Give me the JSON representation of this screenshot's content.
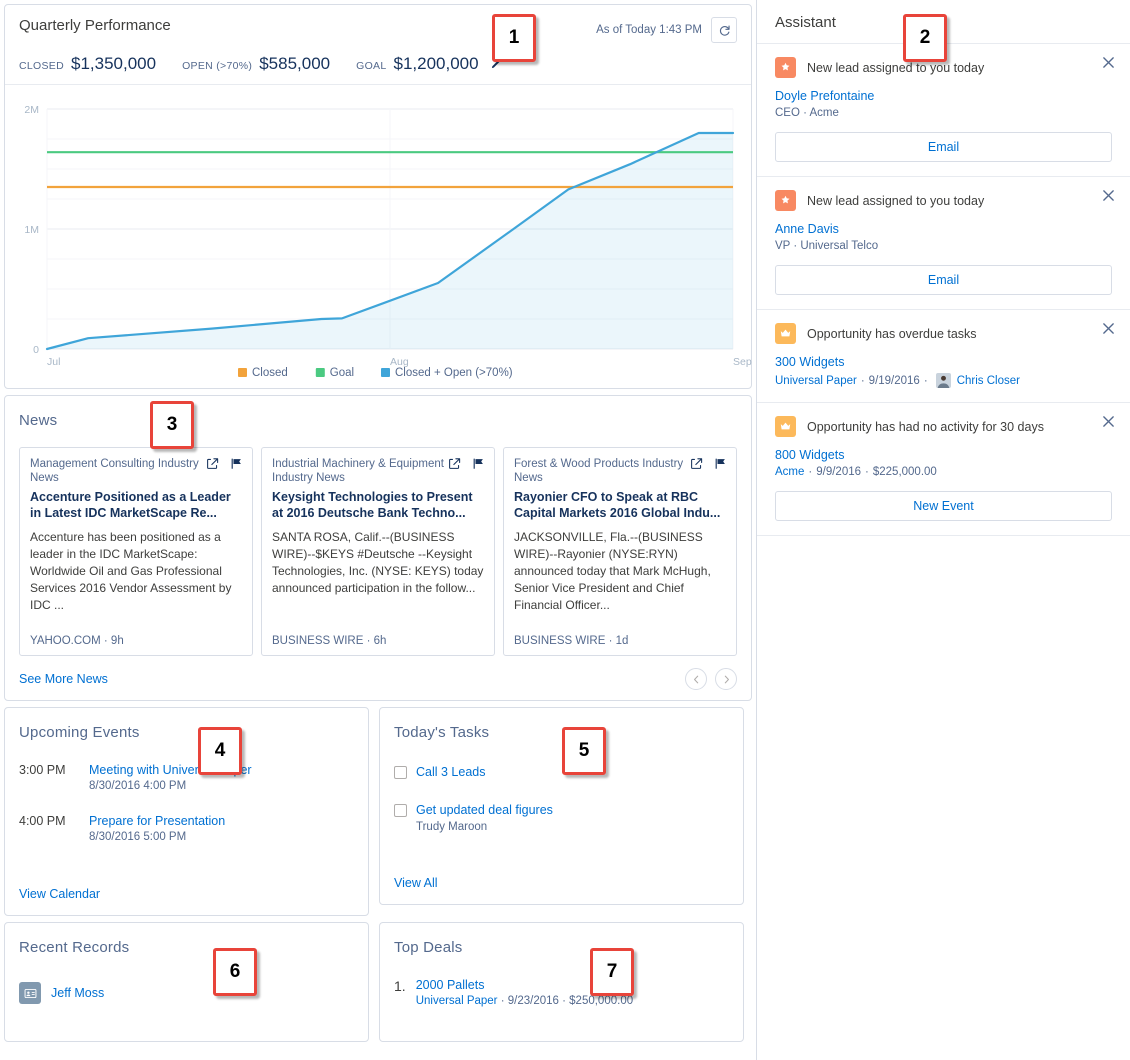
{
  "performance": {
    "title": "Quarterly Performance",
    "as_of": "As of Today 1:43 PM",
    "refresh_icon": "refresh-icon",
    "metrics": [
      {
        "label": "CLOSED",
        "value": "$1,350,000"
      },
      {
        "label": "OPEN (>70%)",
        "value": "$585,000"
      },
      {
        "label": "GOAL",
        "value": "$1,200,000"
      }
    ],
    "edit_icon": "pencil-icon"
  },
  "chart_data": {
    "type": "line",
    "title": "Quarterly Performance",
    "xlabel": "",
    "ylabel": "",
    "ylim": [
      0,
      2000000
    ],
    "yticks": [
      0,
      1000000,
      2000000
    ],
    "ytick_labels": [
      "0",
      "1M",
      "2M"
    ],
    "x": [
      "Jul",
      "Aug",
      "Sep"
    ],
    "xtick_labels": [
      "Jul",
      "Aug",
      "Sep"
    ],
    "grid": true,
    "legend_position": "bottom",
    "series": [
      {
        "name": "Closed",
        "color": "#f2a33c",
        "type": "threshold-line",
        "value": 1350000
      },
      {
        "name": "Goal",
        "color": "#4bca81",
        "type": "threshold-line",
        "value": 1640000
      },
      {
        "name": "Closed + Open (>70%)",
        "color": "#3fa5d9",
        "type": "area-line",
        "points": [
          {
            "x": 0.0,
            "y": 0
          },
          {
            "x": 0.06,
            "y": 90000
          },
          {
            "x": 0.24,
            "y": 170000
          },
          {
            "x": 0.4,
            "y": 250000
          },
          {
            "x": 0.43,
            "y": 255000
          },
          {
            "x": 0.57,
            "y": 550000
          },
          {
            "x": 0.68,
            "y": 1000000
          },
          {
            "x": 0.76,
            "y": 1330000
          },
          {
            "x": 0.85,
            "y": 1540000
          },
          {
            "x": 0.95,
            "y": 1800000
          },
          {
            "x": 1.0,
            "y": 1800000
          }
        ]
      }
    ]
  },
  "news": {
    "title": "News",
    "cards": [
      {
        "category": "Management Consulting Industry News",
        "headline": "Accenture Positioned as a Leader in Latest IDC MarketScape Re...",
        "body": "Accenture has been positioned as a leader in the IDC MarketScape: Worldwide Oil and Gas Professional Services 2016 Vendor Assessment by IDC ...",
        "source": "YAHOO.COM · 9h",
        "share_icon": "share-icon",
        "flag_icon": "flag-icon"
      },
      {
        "category": "Industrial Machinery & Equipment Industry News",
        "headline": "Keysight Technologies to Present at 2016 Deutsche Bank Techno...",
        "body": "SANTA ROSA, Calif.--(BUSINESS WIRE)--$KEYS #Deutsche --Keysight Technologies, Inc. (NYSE: KEYS) today announced participation in the follow...",
        "source": "BUSINESS WIRE · 6h",
        "share_icon": "share-icon",
        "flag_icon": "flag-icon"
      },
      {
        "category": "Forest & Wood Products Industry News",
        "headline": "Rayonier CFO to Speak at RBC Capital Markets 2016 Global Indu...",
        "body": "JACKSONVILLE, Fla.--(BUSINESS WIRE)--Rayonier (NYSE:RYN) announced today that Mark McHugh, Senior Vice President and Chief Financial Officer...",
        "source": "BUSINESS WIRE · 1d",
        "share_icon": "share-icon",
        "flag_icon": "flag-icon"
      }
    ],
    "see_more": "See More News",
    "prev_icon": "chevron-left-icon",
    "next_icon": "chevron-right-icon"
  },
  "events": {
    "title": "Upcoming Events",
    "items": [
      {
        "time": "3:00 PM",
        "name": "Meeting with Universal Paper",
        "detail": "8/30/2016 4:00 PM"
      },
      {
        "time": "4:00 PM",
        "name": "Prepare for Presentation",
        "detail": "8/30/2016 5:00 PM"
      }
    ],
    "view_link": "View Calendar"
  },
  "tasks": {
    "title": "Today's Tasks",
    "items": [
      {
        "name": "Call 3 Leads",
        "detail": ""
      },
      {
        "name": "Get updated deal figures",
        "detail": "Trudy Maroon"
      }
    ],
    "view_link": "View All"
  },
  "recent_records": {
    "title": "Recent Records",
    "items": [
      {
        "name": "Jeff Moss",
        "icon": "contact-icon",
        "icon_color": "#8199af"
      }
    ]
  },
  "top_deals": {
    "title": "Top Deals",
    "items": [
      {
        "rank": "1.",
        "name": "2000 Pallets",
        "account": "Universal Paper",
        "date": "9/23/2016",
        "amount": "$250,000.00"
      }
    ]
  },
  "assistant": {
    "title": "Assistant",
    "items": [
      {
        "icon": "lead-star-icon",
        "icon_color": "#f88962",
        "headline": "New lead assigned to you today",
        "link": "Doyle Prefontaine",
        "meta": "CEO · Acme",
        "button": "Email",
        "close_icon": "close-icon"
      },
      {
        "icon": "lead-star-icon",
        "icon_color": "#f88962",
        "headline": "New lead assigned to you today",
        "link": "Anne Davis",
        "meta": "VP · Universal Telco",
        "button": "Email",
        "close_icon": "close-icon"
      },
      {
        "icon": "opportunity-crown-icon",
        "icon_color": "#fcb95b",
        "headline": "Opportunity has overdue tasks",
        "link": "300 Widgets",
        "account": "Universal Paper",
        "date": "9/19/2016",
        "person": "Chris Closer",
        "avatar": "user-avatar",
        "close_icon": "close-icon"
      },
      {
        "icon": "opportunity-crown-icon",
        "icon_color": "#fcb95b",
        "headline": "Opportunity has had no activity for 30 days",
        "link": "800 Widgets",
        "account": "Acme",
        "date": "9/9/2016",
        "amount": "$225,000.00",
        "button": "New Event",
        "close_icon": "close-icon"
      }
    ]
  },
  "callouts": [
    {
      "number": "1"
    },
    {
      "number": "2"
    },
    {
      "number": "3"
    },
    {
      "number": "4"
    },
    {
      "number": "5"
    },
    {
      "number": "6"
    },
    {
      "number": "7"
    }
  ]
}
